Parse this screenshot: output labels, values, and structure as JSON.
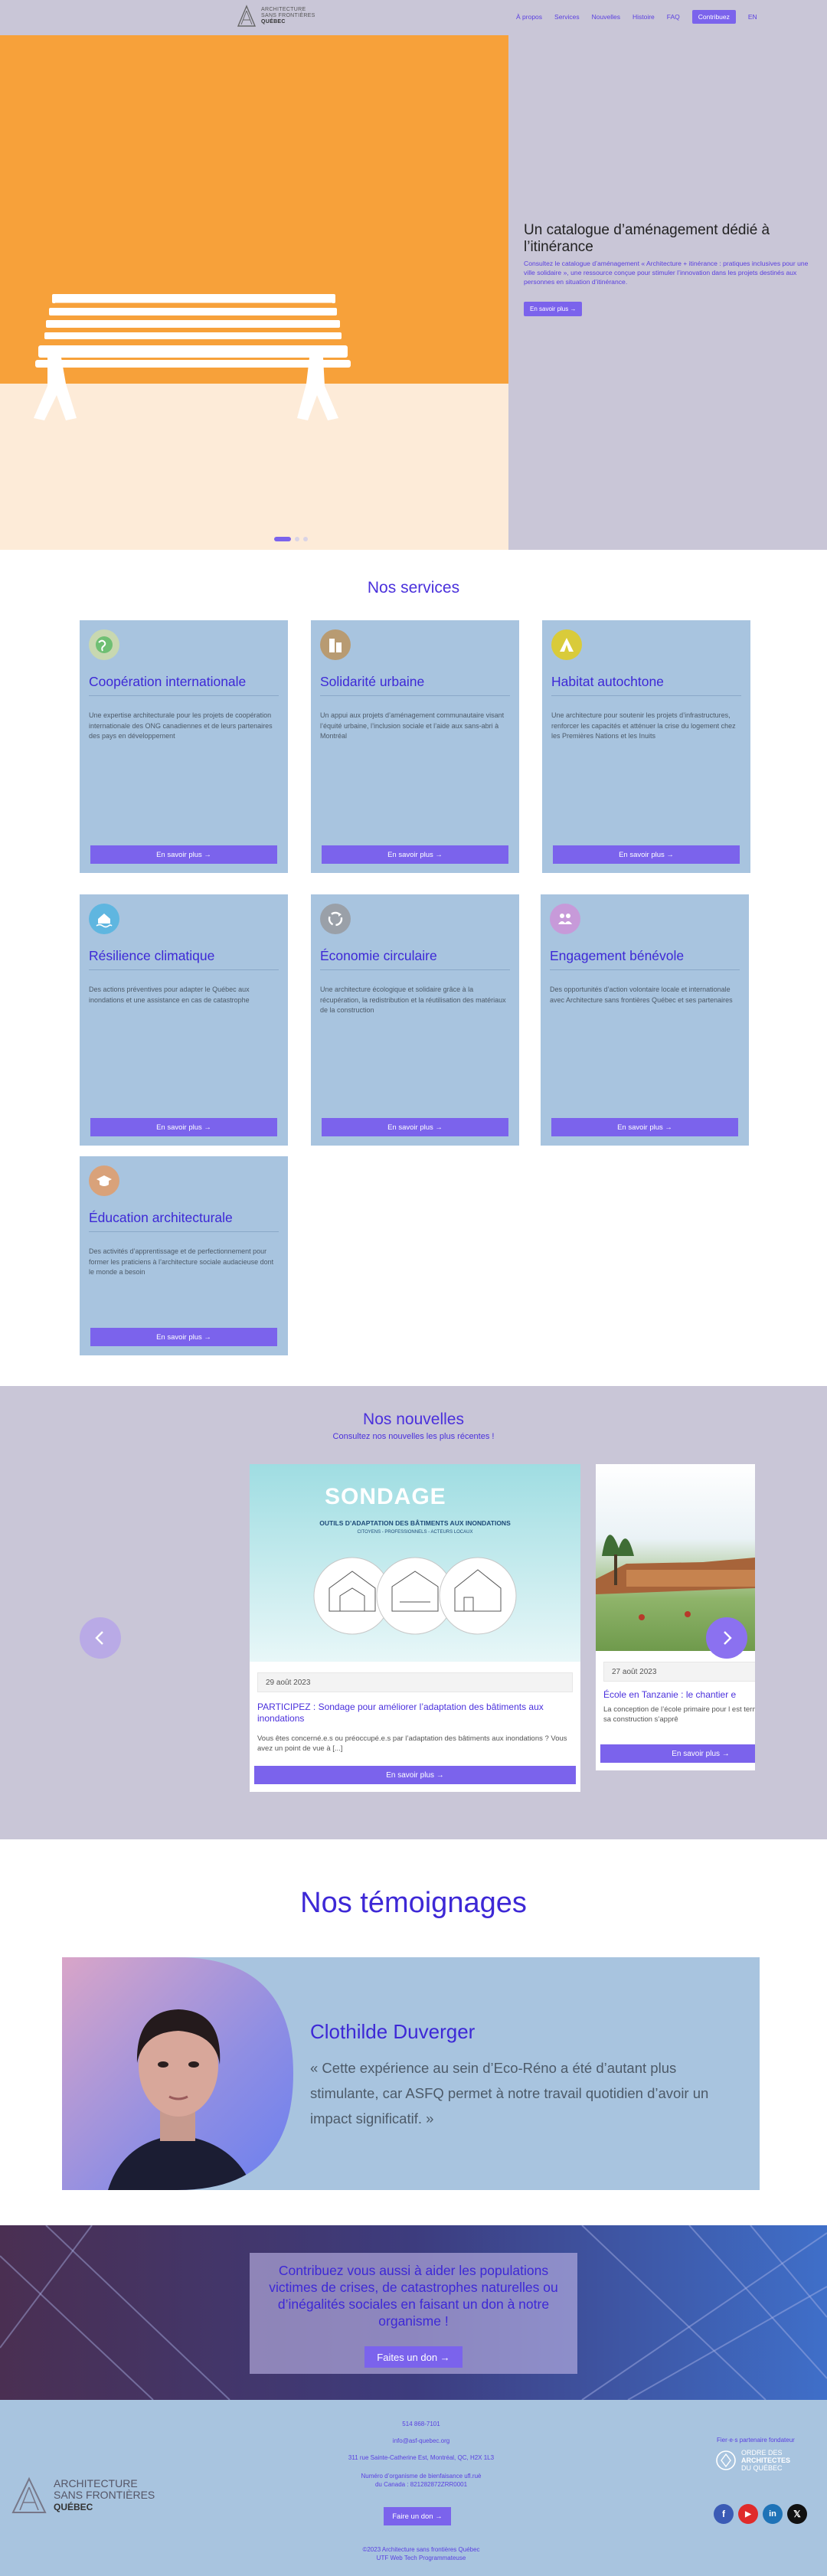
{
  "header": {
    "logo_line1": "ARCHITECTURE",
    "logo_line2": "SANS FRONTIÈRES",
    "logo_line3": "QUÉBEC",
    "nav": [
      "À propos",
      "Services",
      "Nouvelles",
      "Histoire",
      "FAQ"
    ],
    "donate_label": "Contribuez",
    "lang_label": "EN"
  },
  "hero": {
    "title": "Un catalogue d’aménagement dédié à l’itinérance",
    "description": "Consultez le catalogue d’aménagement « Architecture + itinérance : pratiques inclusives pour une ville solidaire », une ressource conçue pour stimuler l’innovation dans les projets destinés aux personnes en situation d’itinérance.",
    "button_label": "En savoir plus →",
    "slides": 3,
    "active_slide": 1
  },
  "services": {
    "title": "Nos services",
    "button_label": "En savoir plus →",
    "items": [
      {
        "title": "Coopération internationale",
        "text": "Une expertise architecturale pour les projets de coopération internationale des ONG canadiennes et de leurs partenaires des pays en développement",
        "icon": "globe-icon",
        "icon_color": "#6fbf73"
      },
      {
        "title": "Solidarité urbaine",
        "text": "Un appui aux projets d’aménagement communautaire visant l’équité urbaine, l’inclusion sociale et l’aide aux sans-abri à Montréal",
        "icon": "building-icon",
        "icon_color": "#b89b72"
      },
      {
        "title": "Habitat autochtone",
        "text": "Une architecture pour soutenir les projets d’infrastructures, renforcer les capacités et atténuer la crise du logement chez les Premières Nations et les Inuits",
        "icon": "tent-icon",
        "icon_color": "#d9cb3a"
      },
      {
        "title": "Résilience climatique",
        "text": "Des actions préventives pour adapter le Québec aux inondations et une assistance en cas de catastrophe",
        "icon": "flood-house-icon",
        "icon_color": "#5fb6e0"
      },
      {
        "title": "Économie circulaire",
        "text": "Une architecture écologique et solidaire grâce à la récupération, la redistribution et la réutilisation des matériaux de la construction",
        "icon": "recycle-icon",
        "icon_color": "#9aa0a8"
      },
      {
        "title": "Engagement bénévole",
        "text": "Des opportunités d’action volontaire locale et internationale avec Architecture sans frontières Québec et ses partenaires",
        "icon": "people-icon",
        "icon_color": "#c79ad9"
      },
      {
        "title": "Éducation architecturale",
        "text": "Des activités d’apprentissage et de perfectionnement pour former les praticiens à l’architecture sociale audacieuse dont le monde a besoin",
        "icon": "graduation-cap-icon",
        "icon_color": "#d9a27a"
      }
    ]
  },
  "news": {
    "title": "Nos nouvelles",
    "subtitle": "Consultez nos nouvelles les plus récentes !",
    "button_label": "En savoir plus →",
    "items": [
      {
        "image_heading": "SONDAGE",
        "image_subheading": "OUTILS D’ADAPTATION DES BÂTIMENTS AUX INONDATIONS",
        "image_caption": "CITOYENS - PROFESSIONNELS - ACTEURS LOCAUX",
        "date": "29 août 2023",
        "title": "PARTICIPEZ : Sondage pour améliorer l’adaptation des bâtiments aux inondations",
        "text": "Vous êtes concerné.e.s ou préoccupé.e.s par l’adaptation des bâtiments aux inondations ? Vous avez un point de vue à [...]"
      },
      {
        "date": "27 août 2023",
        "title": "École en Tanzanie : le chantier e",
        "text": "La conception de l’école primaire pour l est terminée et sa construction s’apprê"
      }
    ]
  },
  "testimonials": {
    "title": "Nos témoignages",
    "name": "Clothilde Duverger",
    "quote": "« Cette expérience au sein d’Eco-Réno a été d’autant plus stimulante, car ASFQ permet à notre travail quotidien d’avoir un impact significatif. »"
  },
  "donate": {
    "text": "Contribuez vous aussi à aider les populations victimes de crises, de catastrophes naturelles ou d’inégalités sociales en faisant un don à notre organisme !",
    "button_label": "Faites un don →"
  },
  "footer": {
    "phone": "514 868-7101",
    "email": "info@asf-quebec.org",
    "address": "311 rue Sainte-Catherine Est, Montréal, QC, H2X 1L3",
    "charity_line1": "Numéro d’organisme de bienfaisance ufl.ruè",
    "charity_line2": "du Canada : 821282872ZRR0001",
    "donate_label": "Faire un don →",
    "copyright": "©2023 Architecture sans frontières Québec",
    "credit": "UTF Web Tech Programmateuse",
    "partner_label": "Fier·e·s partenaire fondateur",
    "partner_name_1": "ORDRE DES",
    "partner_name_2": "ARCHITECTES",
    "partner_name_3": "DU QUÉBEC",
    "logo_line1": "ARCHITECTURE",
    "logo_line2": "SANS FRONTIÈRES",
    "logo_line3": "QUÉBEC",
    "socials": [
      {
        "name": "facebook-icon",
        "glyph": "f",
        "color": "#3b5bb5"
      },
      {
        "name": "youtube-icon",
        "glyph": "▶",
        "color": "#e02b2b"
      },
      {
        "name": "linkedin-icon",
        "glyph": "in",
        "color": "#1f73b7"
      },
      {
        "name": "x-icon",
        "glyph": "𝕏",
        "color": "#111111"
      }
    ]
  }
}
